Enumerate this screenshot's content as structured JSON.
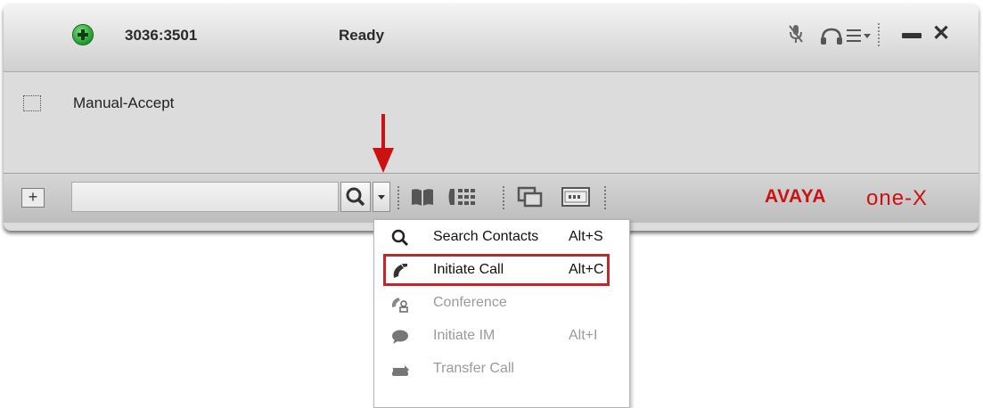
{
  "titlebar": {
    "extension": "3036:3501",
    "status": "Ready",
    "icons": [
      "status-available-icon",
      "mute-microphone-icon",
      "headset-icon",
      "menu-icon",
      "minimize-icon",
      "close-icon"
    ],
    "close_glyph": "✕"
  },
  "line": {
    "label": "Manual-Accept"
  },
  "toolbar": {
    "add_glyph": "+",
    "search_value": "",
    "brand_main": "AVAYA",
    "brand_sub": "one-X"
  },
  "menu": {
    "items": [
      {
        "label": "Search Contacts",
        "shortcut": "Alt+S",
        "icon": "search-icon",
        "enabled": true
      },
      {
        "label": "Initiate Call",
        "shortcut": "Alt+C",
        "icon": "phone-icon",
        "enabled": true,
        "highlighted": true
      },
      {
        "label": "Conference",
        "shortcut": "",
        "icon": "conference-icon",
        "enabled": false
      },
      {
        "label": "Initiate IM",
        "shortcut": "Alt+I",
        "icon": "chat-bubble-icon",
        "enabled": false
      },
      {
        "label": "Transfer Call",
        "shortcut": "",
        "icon": "transfer-icon",
        "enabled": false
      }
    ]
  },
  "colors": {
    "accent_red": "#cc1111",
    "highlight_border": "#c0282c",
    "status_green": "#1c9a2c",
    "disabled_text": "#9a9a9a"
  }
}
